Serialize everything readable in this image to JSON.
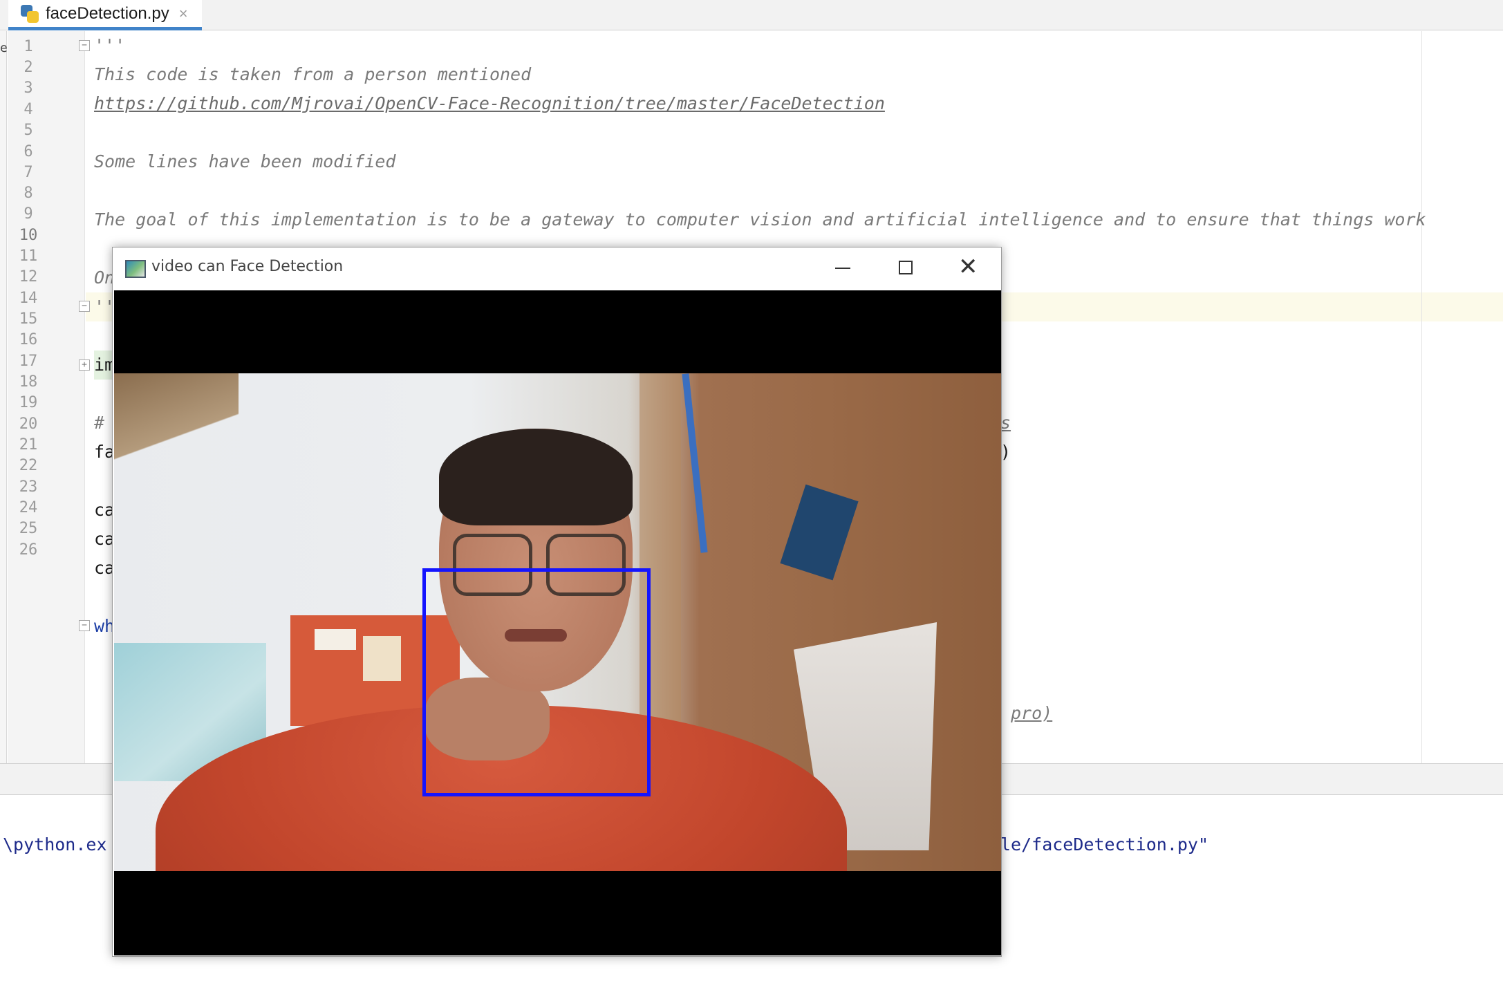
{
  "editor_tab": {
    "filename": "faceDetection.py",
    "close_glyph": "×",
    "icon": "python-file-icon"
  },
  "left_edge_fragment": "e",
  "line_numbers": [
    "1",
    "2",
    "3",
    "4",
    "5",
    "6",
    "7",
    "8",
    "9",
    "10",
    "11",
    "12",
    "14",
    "15",
    "16",
    "17",
    "18",
    "19",
    "20",
    "21",
    "22",
    "23",
    "24",
    "25",
    "26"
  ],
  "current_line": "10",
  "code": {
    "l1": "'''",
    "l2": "This code is taken from a person mentioned",
    "l3": "https://github.com/Mjrovai/OpenCV-Face-Recognition/tree/master/FaceDetection",
    "l5": "Some lines have been modified",
    "l7": "The goal of this implementation is to be a gateway to computer vision and artificial intelligence and to ensure that things work",
    "l9": "On",
    "l10": "''",
    "l12": "im",
    "l15_start": "#",
    "l15_end": "s",
    "l16_start": "fa",
    "l16_end": ")",
    "l18": "ca",
    "l19": "ca",
    "l20": "ca",
    "l22": "wh",
    "l25_end": "pro)"
  },
  "console": {
    "left_text": "\\python.ex",
    "right_text": "le/faceDetection.py\""
  },
  "video_window": {
    "title": "video can Face Detection",
    "icon": "opencv-window-icon",
    "minimize_icon": "minimize-icon",
    "maximize_icon": "maximize-icon",
    "close_icon": "close-icon",
    "close_glyph": "✕",
    "detection_box_color": "#1414ff"
  },
  "colors": {
    "tab_accent": "#4083c9",
    "comment": "#7a7a7a",
    "keyword": "#1d3fa6",
    "console_text": "#1d2a8a",
    "current_line_bg": "#fcfae9"
  }
}
